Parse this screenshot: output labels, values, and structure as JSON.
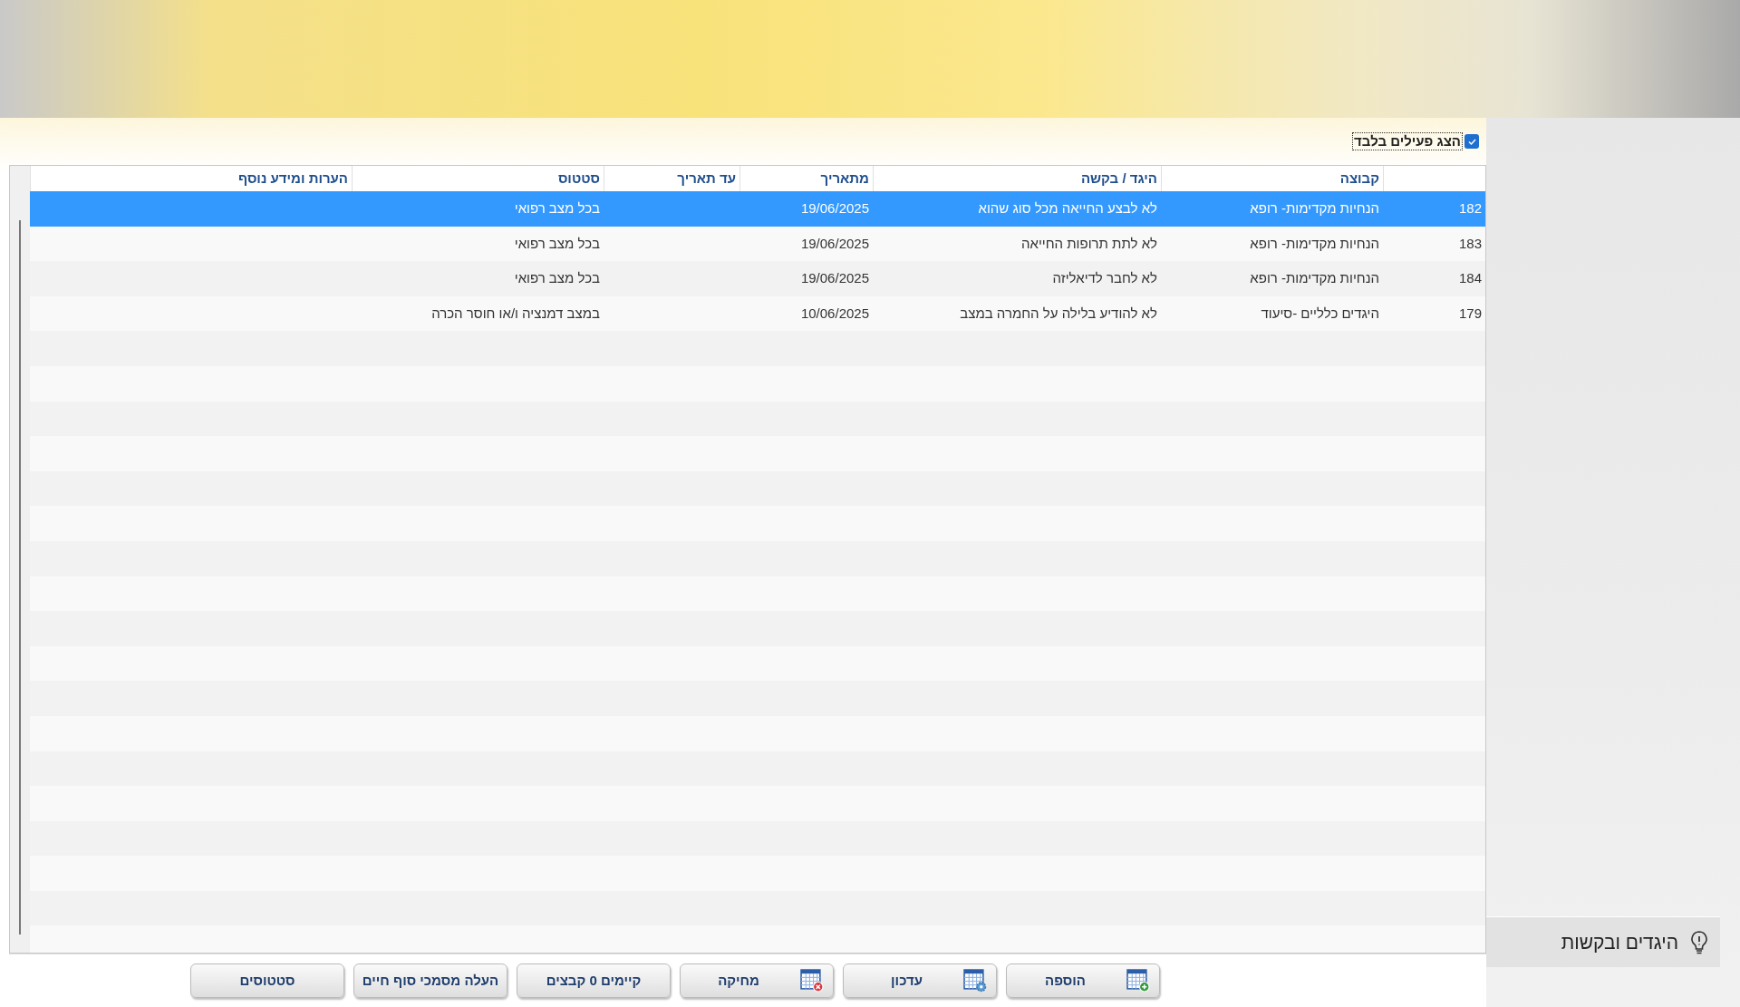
{
  "filter": {
    "label": "הצג פעילים בלבד",
    "checked": true
  },
  "table": {
    "columns": [
      "קבוצה",
      "היגד / בקשה",
      "מתאריך",
      "עד תאריך",
      "סטטוס",
      "הערות ומידע נוסף"
    ],
    "rows": [
      {
        "id": "182",
        "group": "הנחיות מקדימות- רופא",
        "statement": "לא לבצע החייאה מכל סוג שהוא",
        "from": "19/06/2025",
        "status": "בכל מצב רפואי",
        "selected": true
      },
      {
        "id": "183",
        "group": "הנחיות מקדימות- רופא",
        "statement": "לא לתת תרופות החייאה",
        "from": "19/06/2025",
        "status": "בכל מצב רפואי",
        "selected": false
      },
      {
        "id": "184",
        "group": "הנחיות מקדימות- רופא",
        "statement": "לא לחבר לדיאליזה",
        "from": "19/06/2025",
        "status": "בכל מצב רפואי",
        "selected": false
      },
      {
        "id": "179",
        "group": "היגדים כלליים -סיעוד",
        "statement": "לא להודיע בלילה על החמרה במצב",
        "from": "10/06/2025",
        "status": "במצב דמנציה ו/או חוסר הכרה",
        "selected": false
      }
    ]
  },
  "buttons": [
    {
      "label": "הוספה",
      "kind": "add"
    },
    {
      "label": "עדכון",
      "kind": "edit"
    },
    {
      "label": "מחיקה",
      "kind": "delete"
    },
    {
      "label": "קיימים 0 קבצים",
      "kind": "plain"
    },
    {
      "label": "העלה מסמכי סוף חיים",
      "kind": "plain"
    },
    {
      "label": "סטטוסים",
      "kind": "plain"
    }
  ],
  "side_panel": {
    "title": "היגדים ובקשות"
  }
}
